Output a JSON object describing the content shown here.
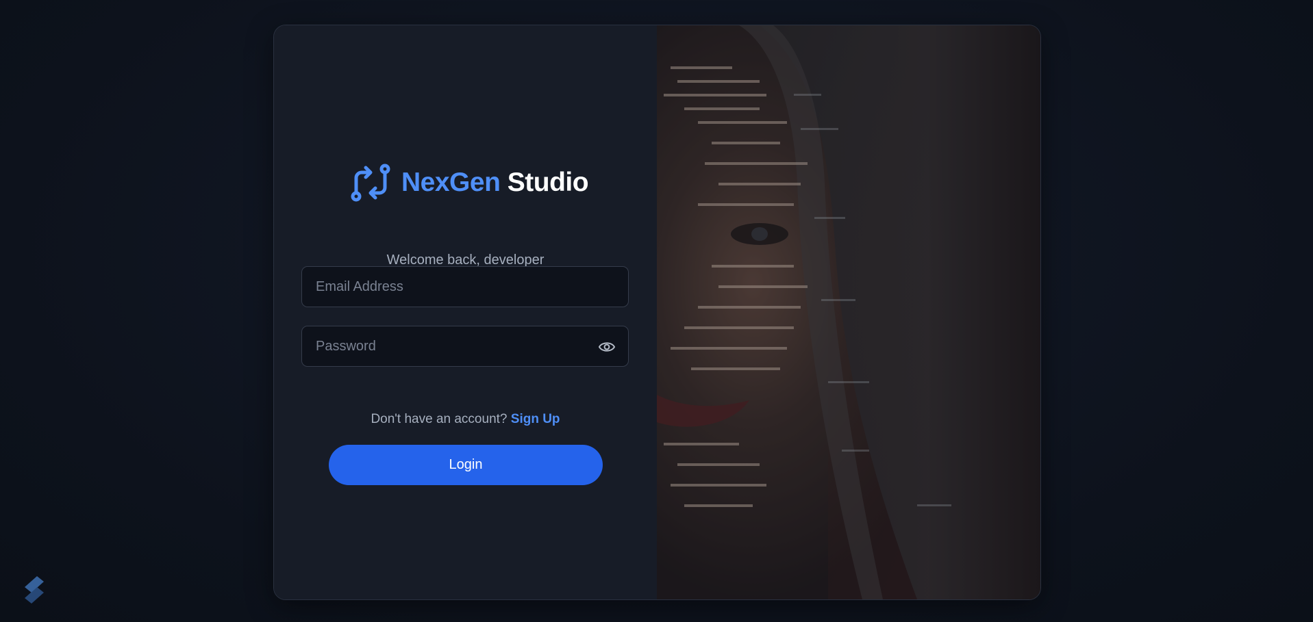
{
  "brand": {
    "name_part1": "NexGen",
    "name_part2": "Studio",
    "logo_icon": "git-compare-icon",
    "accent_color": "#4f8ff7"
  },
  "login": {
    "subtitle": "Welcome back, developer",
    "email_placeholder": "Email Address",
    "password_placeholder": "Password",
    "show_password_icon": "eye-icon",
    "signup_prompt": "Don't have an account?",
    "signup_link": "Sign Up",
    "login_button": "Login",
    "button_color": "#2563eb"
  },
  "hero": {
    "image_description_icon": "hero-photo"
  },
  "footer": {
    "corner_logo_icon": "app-logo-icon"
  }
}
